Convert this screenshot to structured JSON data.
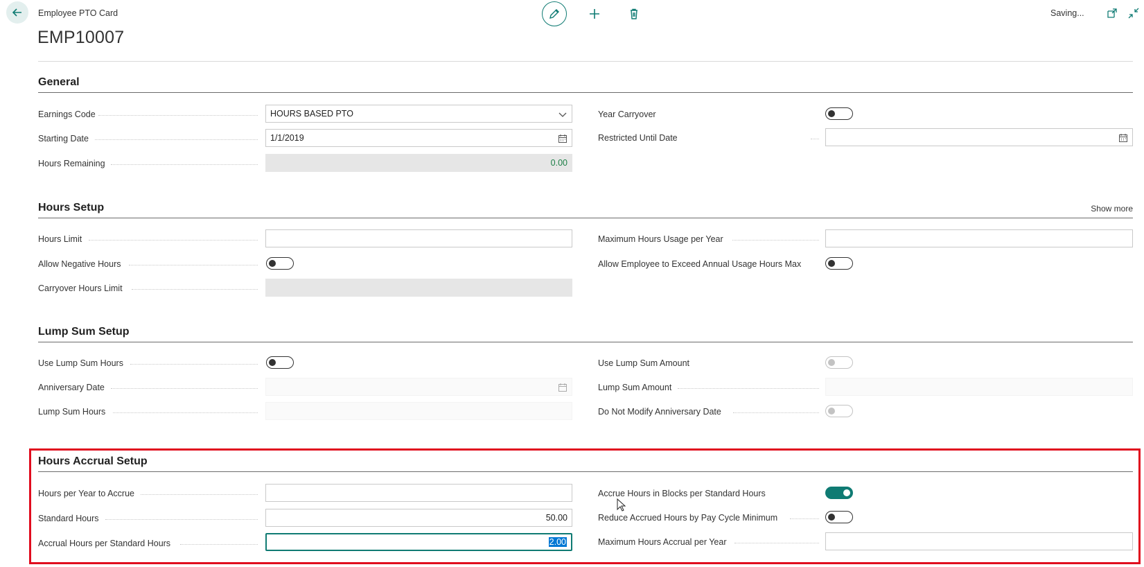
{
  "header": {
    "caption": "Employee PTO Card",
    "title": "EMP10007",
    "status": "Saving..."
  },
  "sections": {
    "general": {
      "title": "General",
      "earnings_code_label": "Earnings Code",
      "earnings_code_value": "HOURS BASED PTO",
      "starting_date_label": "Starting Date",
      "starting_date_value": "1/1/2019",
      "hours_remaining_label": "Hours Remaining",
      "hours_remaining_value": "0.00",
      "year_carryover_label": "Year Carryover",
      "year_carryover_on": false,
      "restricted_until_label": "Restricted Until Date",
      "restricted_until_value": ""
    },
    "hours_setup": {
      "title": "Hours Setup",
      "show_more": "Show more",
      "hours_limit_label": "Hours Limit",
      "hours_limit_value": "",
      "allow_negative_label": "Allow Negative Hours",
      "allow_negative_on": false,
      "carryover_limit_label": "Carryover Hours Limit",
      "carryover_limit_value": "",
      "max_usage_label": "Maximum Hours Usage per Year",
      "max_usage_value": "",
      "allow_exceed_label": "Allow Employee to Exceed Annual Usage Hours Max",
      "allow_exceed_on": false
    },
    "lump_sum": {
      "title": "Lump Sum Setup",
      "use_lump_hours_label": "Use Lump Sum Hours",
      "use_lump_hours_on": false,
      "anniversary_label": "Anniversary Date",
      "anniversary_value": "",
      "lump_hours_label": "Lump Sum Hours",
      "lump_hours_value": "",
      "use_lump_amount_label": "Use Lump Sum Amount",
      "use_lump_amount_on": false,
      "lump_amount_label": "Lump Sum Amount",
      "lump_amount_value": "",
      "no_modify_label": "Do Not Modify Anniversary Date",
      "no_modify_on": false
    },
    "accrual": {
      "title": "Hours Accrual Setup",
      "per_year_label": "Hours per Year to Accrue",
      "per_year_value": "",
      "standard_hours_label": "Standard Hours",
      "standard_hours_value": "50.00",
      "accrual_per_std_label": "Accrual Hours per Standard Hours",
      "accrual_per_std_value": "2.00",
      "blocks_label": "Accrue Hours in Blocks per Standard Hours",
      "blocks_on": true,
      "reduce_label": "Reduce Accrued Hours by Pay Cycle Minimum",
      "reduce_on": false,
      "max_accrual_label": "Maximum Hours Accrual per Year",
      "max_accrual_value": ""
    }
  },
  "colors": {
    "accent": "#0f7b73",
    "highlight_box": "#e00c1e",
    "selection": "#0078d4"
  },
  "icons": [
    "back-arrow-icon",
    "pencil-icon",
    "plus-icon",
    "trash-icon",
    "popout-icon",
    "collapse-icon",
    "chevron-down-icon",
    "calendar-icon",
    "mouse-cursor-icon"
  ]
}
